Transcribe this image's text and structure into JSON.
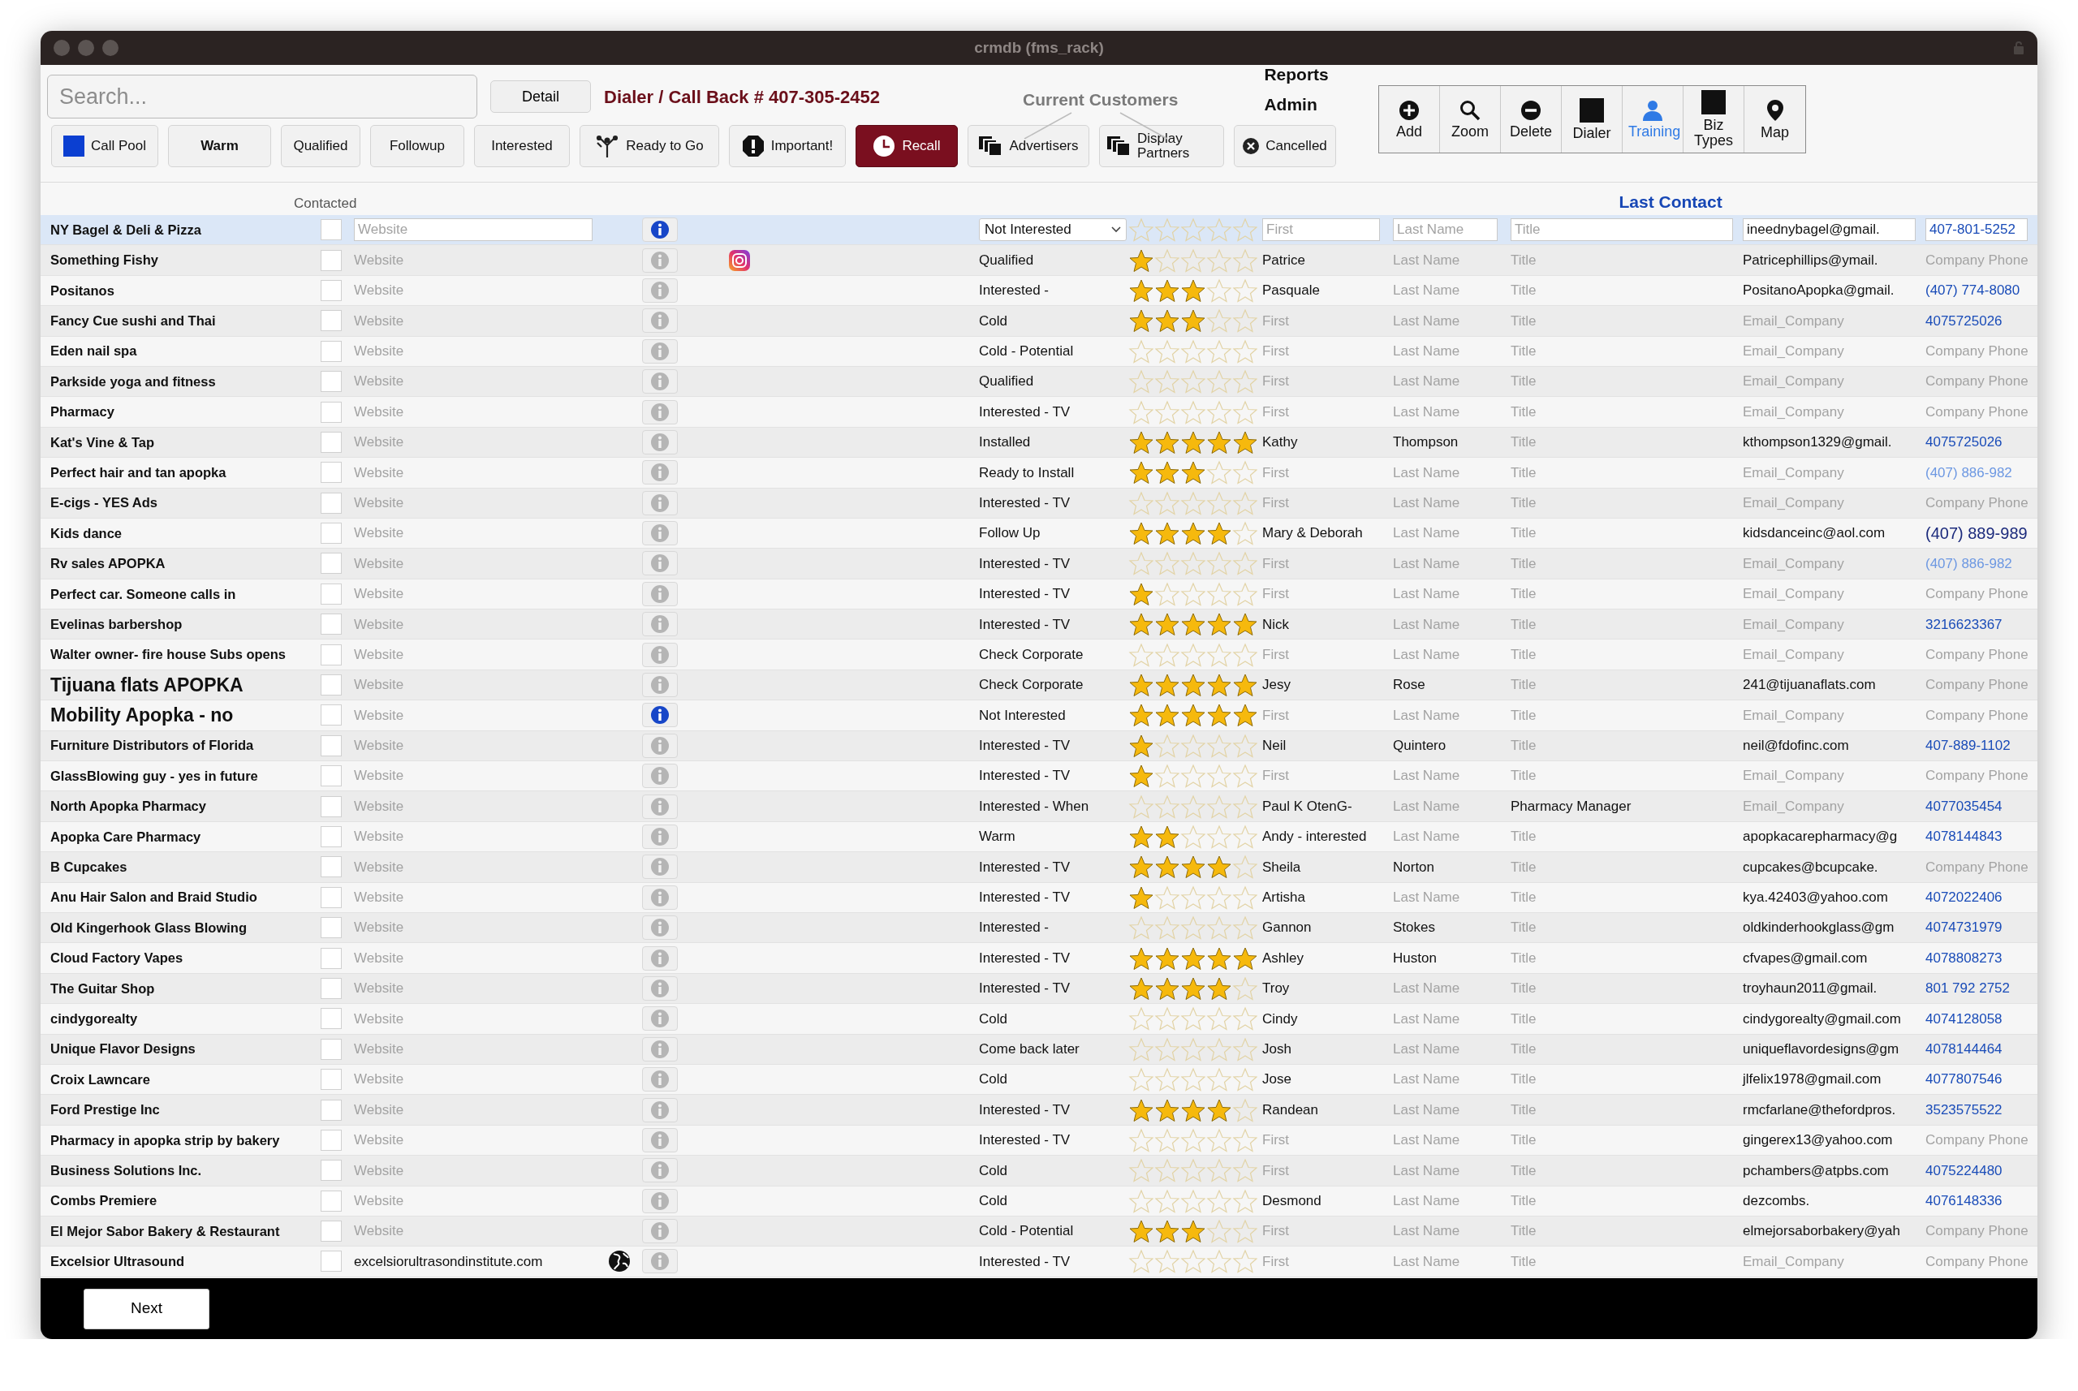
{
  "window": {
    "title": "crmdb (fms_rack)"
  },
  "search": {
    "placeholder": "Search..."
  },
  "detail_button": "Detail",
  "dialer_title": "Dialer / Call Back # 407-305-2452",
  "current_customers": "Current Customers",
  "menu_links": [
    "Reports",
    "Admin"
  ],
  "filters": [
    {
      "label": "Call Pool",
      "bold": false,
      "selected": false
    },
    {
      "label": "Warm",
      "bold": true,
      "selected": false
    },
    {
      "label": "Qualified",
      "bold": false,
      "selected": false
    },
    {
      "label": "Followup",
      "bold": false,
      "selected": false
    },
    {
      "label": "Interested",
      "bold": false,
      "selected": false
    },
    {
      "label": "Ready to Go",
      "bold": false,
      "selected": false
    },
    {
      "label": "Important!",
      "bold": false,
      "selected": false
    },
    {
      "label": "Recall",
      "bold": false,
      "selected": true
    },
    {
      "label": "Advertisers",
      "bold": false,
      "selected": false
    },
    {
      "label": "Display Partners",
      "bold": false,
      "selected": false
    },
    {
      "label": "Cancelled",
      "bold": false,
      "selected": false
    }
  ],
  "tools": [
    {
      "label": "Add",
      "selected": false
    },
    {
      "label": "Zoom",
      "selected": false
    },
    {
      "label": "Delete",
      "selected": false
    },
    {
      "label": "Dialer",
      "selected": false
    },
    {
      "label": "Training",
      "selected": true
    },
    {
      "label": "Biz Types",
      "selected": false
    },
    {
      "label": "Map",
      "selected": false
    }
  ],
  "column_headers": {
    "contacted": "Contacted",
    "last_contact": "Last Contact"
  },
  "rows": [
    {
      "name": "NY Bagel & Deli & Pizza",
      "large_name": false,
      "selected": true,
      "contacted": false,
      "website": {
        "placeholder": "Website"
      },
      "social": false,
      "has_info": true,
      "status": "Not Interested",
      "stars": 0,
      "first": {
        "placeholder": "First"
      },
      "last": {
        "placeholder": "Last Name"
      },
      "title": {
        "placeholder": "Title"
      },
      "email": "ineednybagel@gmail.",
      "phone": {
        "value": "407-801-5252",
        "kind": "link"
      }
    },
    {
      "name": "Something Fishy",
      "large_name": false,
      "selected": false,
      "contacted": false,
      "website": {
        "placeholder": "Website"
      },
      "social": true,
      "has_info": false,
      "status": "Qualified",
      "stars": 1,
      "first": "Patrice",
      "last": {
        "placeholder": "Last Name"
      },
      "title": {
        "placeholder": "Title"
      },
      "email": "Patricephillips@ymail.",
      "phone": {
        "placeholder": "Company Phone"
      }
    },
    {
      "name": "Positanos",
      "large_name": false,
      "selected": false,
      "contacted": false,
      "website": {
        "placeholder": "Website"
      },
      "social": false,
      "has_info": false,
      "status": "Interested -",
      "stars": 3,
      "first": "Pasquale",
      "last": {
        "placeholder": "Last Name"
      },
      "title": {
        "placeholder": "Title"
      },
      "email": "PositanoApopka@gmail.",
      "phone": {
        "value": "(407) 774-8080",
        "kind": "link"
      }
    },
    {
      "name": "Fancy Cue sushi and Thai",
      "large_name": false,
      "selected": false,
      "contacted": false,
      "website": {
        "placeholder": "Website"
      },
      "social": false,
      "has_info": false,
      "status": "Cold",
      "stars": 3,
      "first": {
        "placeholder": "First"
      },
      "last": {
        "placeholder": "Last Name"
      },
      "title": {
        "placeholder": "Title"
      },
      "email": {
        "placeholder": "Email_Company"
      },
      "phone": {
        "value": "4075725026",
        "kind": "link"
      }
    },
    {
      "name": "Eden nail spa",
      "large_name": false,
      "selected": false,
      "contacted": false,
      "website": {
        "placeholder": "Website"
      },
      "social": false,
      "has_info": false,
      "status": "Cold - Potential",
      "stars": 0,
      "first": {
        "placeholder": "First"
      },
      "last": {
        "placeholder": "Last Name"
      },
      "title": {
        "placeholder": "Title"
      },
      "email": {
        "placeholder": "Email_Company"
      },
      "phone": {
        "placeholder": "Company Phone"
      }
    },
    {
      "name": "Parkside yoga and fitness",
      "large_name": false,
      "selected": false,
      "contacted": false,
      "website": {
        "placeholder": "Website"
      },
      "social": false,
      "has_info": false,
      "status": "Qualified",
      "stars": 0,
      "first": {
        "placeholder": "First"
      },
      "last": {
        "placeholder": "Last Name"
      },
      "title": {
        "placeholder": "Title"
      },
      "email": {
        "placeholder": "Email_Company"
      },
      "phone": {
        "placeholder": "Company Phone"
      }
    },
    {
      "name": "Pharmacy",
      "large_name": false,
      "selected": false,
      "contacted": false,
      "website": {
        "placeholder": "Website"
      },
      "social": false,
      "has_info": false,
      "status": "Interested - TV",
      "stars": 0,
      "first": {
        "placeholder": "First"
      },
      "last": {
        "placeholder": "Last Name"
      },
      "title": {
        "placeholder": "Title"
      },
      "email": {
        "placeholder": "Email_Company"
      },
      "phone": {
        "placeholder": "Company Phone"
      }
    },
    {
      "name": "Kat's Vine & Tap",
      "large_name": false,
      "selected": false,
      "contacted": false,
      "website": {
        "placeholder": "Website"
      },
      "social": false,
      "has_info": false,
      "status": "Installed",
      "stars": 5,
      "first": "Kathy",
      "last": "Thompson",
      "title": {
        "placeholder": "Title"
      },
      "email": "kthompson1329@gmail.",
      "phone": {
        "value": "4075725026",
        "kind": "link"
      }
    },
    {
      "name": "Perfect hair and tan apopka",
      "large_name": false,
      "selected": false,
      "contacted": false,
      "website": {
        "placeholder": "Website"
      },
      "social": false,
      "has_info": false,
      "status": "Ready to Install",
      "stars": 3,
      "first": {
        "placeholder": "First"
      },
      "last": {
        "placeholder": "Last Name"
      },
      "title": {
        "placeholder": "Title"
      },
      "email": {
        "placeholder": "Email_Company"
      },
      "phone": {
        "value": "(407) 886-982",
        "kind": "faded"
      }
    },
    {
      "name": "E-cigs - YES Ads",
      "large_name": false,
      "selected": false,
      "contacted": false,
      "website": {
        "placeholder": "Website"
      },
      "social": false,
      "has_info": false,
      "status": "Interested - TV",
      "stars": 0,
      "first": {
        "placeholder": "First"
      },
      "last": {
        "placeholder": "Last Name"
      },
      "title": {
        "placeholder": "Title"
      },
      "email": {
        "placeholder": "Email_Company"
      },
      "phone": {
        "placeholder": "Company Phone"
      }
    },
    {
      "name": "Kids dance",
      "large_name": false,
      "selected": false,
      "contacted": false,
      "website": {
        "placeholder": "Website"
      },
      "social": false,
      "has_info": false,
      "status": "Follow Up",
      "stars": 4,
      "first": "Mary & Deborah",
      "last": {
        "placeholder": "Last Name"
      },
      "title": {
        "placeholder": "Title"
      },
      "email": "kidsdanceinc@aol.com",
      "phone": {
        "value": "(407) 889-989",
        "kind": "large"
      }
    },
    {
      "name": "Rv sales APOPKA",
      "large_name": false,
      "selected": false,
      "contacted": false,
      "website": {
        "placeholder": "Website"
      },
      "social": false,
      "has_info": false,
      "status": "Interested - TV",
      "stars": 0,
      "first": {
        "placeholder": "First"
      },
      "last": {
        "placeholder": "Last Name"
      },
      "title": {
        "placeholder": "Title"
      },
      "email": {
        "placeholder": "Email_Company"
      },
      "phone": {
        "value": "(407) 886-982",
        "kind": "faded"
      }
    },
    {
      "name": "Perfect car. Someone calls in",
      "large_name": false,
      "selected": false,
      "contacted": false,
      "website": {
        "placeholder": "Website"
      },
      "social": false,
      "has_info": false,
      "status": "Interested - TV",
      "stars": 1,
      "first": {
        "placeholder": "First"
      },
      "last": {
        "placeholder": "Last Name"
      },
      "title": {
        "placeholder": "Title"
      },
      "email": {
        "placeholder": "Email_Company"
      },
      "phone": {
        "placeholder": "Company Phone"
      }
    },
    {
      "name": "Evelinas barbershop",
      "large_name": false,
      "selected": false,
      "contacted": false,
      "website": {
        "placeholder": "Website"
      },
      "social": false,
      "has_info": false,
      "status": "Interested - TV",
      "stars": 5,
      "first": "Nick",
      "last": {
        "placeholder": "Last Name"
      },
      "title": {
        "placeholder": "Title"
      },
      "email": {
        "placeholder": "Email_Company"
      },
      "phone": {
        "value": "3216623367",
        "kind": "link"
      }
    },
    {
      "name": "Walter owner- fire house Subs opens",
      "large_name": false,
      "selected": false,
      "contacted": false,
      "website": {
        "placeholder": "Website"
      },
      "social": false,
      "has_info": false,
      "status": "Check Corporate",
      "stars": 0,
      "first": {
        "placeholder": "First"
      },
      "last": {
        "placeholder": "Last Name"
      },
      "title": {
        "placeholder": "Title"
      },
      "email": {
        "placeholder": "Email_Company"
      },
      "phone": {
        "placeholder": "Company Phone"
      }
    },
    {
      "name": "Tijuana flats APOPKA",
      "large_name": true,
      "selected": false,
      "contacted": false,
      "website": {
        "placeholder": "Website"
      },
      "social": false,
      "has_info": false,
      "status": "Check Corporate",
      "stars": 5,
      "first": "Jesy",
      "last": "Rose",
      "title": {
        "placeholder": "Title"
      },
      "email": "241@tijuanaflats.com",
      "phone": {
        "placeholder": "Company Phone"
      }
    },
    {
      "name": "Mobility Apopka - no",
      "large_name": true,
      "selected": false,
      "contacted": false,
      "website": {
        "placeholder": "Website"
      },
      "social": false,
      "has_info": true,
      "status": "Not Interested",
      "stars": 5,
      "first": {
        "placeholder": "First"
      },
      "last": {
        "placeholder": "Last Name"
      },
      "title": {
        "placeholder": "Title"
      },
      "email": {
        "placeholder": "Email_Company"
      },
      "phone": {
        "placeholder": "Company Phone"
      }
    },
    {
      "name": "Furniture Distributors of Florida",
      "large_name": false,
      "selected": false,
      "contacted": false,
      "website": {
        "placeholder": "Website"
      },
      "social": false,
      "has_info": false,
      "status": "Interested - TV",
      "stars": 1,
      "first": "Neil",
      "last": "Quintero",
      "title": {
        "placeholder": "Title"
      },
      "email": "neil@fdofinc.com",
      "phone": {
        "value": "407-889-1102",
        "kind": "link"
      }
    },
    {
      "name": "GlassBlowing guy - yes in future",
      "large_name": false,
      "selected": false,
      "contacted": false,
      "website": {
        "placeholder": "Website"
      },
      "social": false,
      "has_info": false,
      "status": "Interested - TV",
      "stars": 1,
      "first": {
        "placeholder": "First"
      },
      "last": {
        "placeholder": "Last Name"
      },
      "title": {
        "placeholder": "Title"
      },
      "email": {
        "placeholder": "Email_Company"
      },
      "phone": {
        "placeholder": "Company Phone"
      }
    },
    {
      "name": "North Apopka Pharmacy",
      "large_name": false,
      "selected": false,
      "contacted": false,
      "website": {
        "placeholder": "Website"
      },
      "social": false,
      "has_info": false,
      "status": "Interested - When",
      "stars": 0,
      "first": "Paul K OtenG-",
      "last": {
        "placeholder": "Last Name"
      },
      "title": "Pharmacy Manager",
      "email": {
        "placeholder": "Email_Company"
      },
      "phone": {
        "value": "4077035454",
        "kind": "link"
      }
    },
    {
      "name": "Apopka Care Pharmacy",
      "large_name": false,
      "selected": false,
      "contacted": false,
      "website": {
        "placeholder": "Website"
      },
      "social": false,
      "has_info": false,
      "status": "Warm",
      "stars": 2,
      "first": "Andy - interested",
      "last": {
        "placeholder": "Last Name"
      },
      "title": {
        "placeholder": "Title"
      },
      "email": "apopkacarepharmacy@g",
      "phone": {
        "value": "4078144843",
        "kind": "link"
      }
    },
    {
      "name": "B Cupcakes",
      "large_name": false,
      "selected": false,
      "contacted": false,
      "website": {
        "placeholder": "Website"
      },
      "social": false,
      "has_info": false,
      "status": "Interested - TV",
      "stars": 4,
      "first": "Sheila",
      "last": "Norton",
      "title": {
        "placeholder": "Title"
      },
      "email": "cupcakes@bcupcake.",
      "phone": {
        "placeholder": "Company Phone"
      }
    },
    {
      "name": "Anu Hair Salon and Braid Studio",
      "large_name": false,
      "selected": false,
      "contacted": false,
      "website": {
        "placeholder": "Website"
      },
      "social": false,
      "has_info": false,
      "status": "Interested - TV",
      "stars": 1,
      "first": "Artisha",
      "last": {
        "placeholder": "Last Name"
      },
      "title": {
        "placeholder": "Title"
      },
      "email": "kya.42403@yahoo.com",
      "phone": {
        "value": "4072022406",
        "kind": "link"
      }
    },
    {
      "name": "Old Kingerhook Glass Blowing",
      "large_name": false,
      "selected": false,
      "contacted": false,
      "website": {
        "placeholder": "Website"
      },
      "social": false,
      "has_info": false,
      "status": "Interested -",
      "stars": 0,
      "first": "Gannon",
      "last": "Stokes",
      "title": {
        "placeholder": "Title"
      },
      "email": "oldkinderhookglass@gm",
      "phone": {
        "value": "4074731979",
        "kind": "link"
      }
    },
    {
      "name": "Cloud Factory Vapes",
      "large_name": false,
      "selected": false,
      "contacted": false,
      "website": {
        "placeholder": "Website"
      },
      "social": false,
      "has_info": false,
      "status": "Interested - TV",
      "stars": 5,
      "first": "Ashley",
      "last": "Huston",
      "title": {
        "placeholder": "Title"
      },
      "email": "cfvapes@gmail.com",
      "phone": {
        "value": "4078808273",
        "kind": "link"
      }
    },
    {
      "name": "The Guitar Shop",
      "large_name": false,
      "selected": false,
      "contacted": false,
      "website": {
        "placeholder": "Website"
      },
      "social": false,
      "has_info": false,
      "status": "Interested - TV",
      "stars": 4,
      "first": "Troy",
      "last": {
        "placeholder": "Last Name"
      },
      "title": {
        "placeholder": "Title"
      },
      "email": "troyhaun2011@gmail.",
      "phone": {
        "value": "801 792 2752",
        "kind": "link"
      }
    },
    {
      "name": "cindygorealty",
      "large_name": false,
      "selected": false,
      "contacted": false,
      "website": {
        "placeholder": "Website"
      },
      "social": false,
      "has_info": false,
      "status": "Cold",
      "stars": 0,
      "first": "Cindy",
      "last": {
        "placeholder": "Last Name"
      },
      "title": {
        "placeholder": "Title"
      },
      "email": "cindygorealty@gmail.com",
      "phone": {
        "value": "4074128058",
        "kind": "link"
      }
    },
    {
      "name": "Unique Flavor Designs",
      "large_name": false,
      "selected": false,
      "contacted": false,
      "website": {
        "placeholder": "Website"
      },
      "social": false,
      "has_info": false,
      "status": "Come back later",
      "stars": 0,
      "first": "Josh",
      "last": {
        "placeholder": "Last Name"
      },
      "title": {
        "placeholder": "Title"
      },
      "email": "uniqueflavordesigns@gm",
      "phone": {
        "value": "4078144464",
        "kind": "link"
      }
    },
    {
      "name": "Croix Lawncare",
      "large_name": false,
      "selected": false,
      "contacted": false,
      "website": {
        "placeholder": "Website"
      },
      "social": false,
      "has_info": false,
      "status": "Cold",
      "stars": 0,
      "first": "Jose",
      "last": {
        "placeholder": "Last Name"
      },
      "title": {
        "placeholder": "Title"
      },
      "email": "jlfelix1978@gmail.com",
      "phone": {
        "value": "4077807546",
        "kind": "link"
      }
    },
    {
      "name": "Ford Prestige Inc",
      "large_name": false,
      "selected": false,
      "contacted": false,
      "website": {
        "placeholder": "Website"
      },
      "social": false,
      "has_info": false,
      "status": "Interested - TV",
      "stars": 4,
      "first": "Randean",
      "last": {
        "placeholder": "Last Name"
      },
      "title": {
        "placeholder": "Title"
      },
      "email": "rmcfarlane@thefordpros.",
      "phone": {
        "value": "3523575522",
        "kind": "link"
      }
    },
    {
      "name": "Pharmacy in apopka strip by bakery",
      "large_name": false,
      "selected": false,
      "contacted": false,
      "website": {
        "placeholder": "Website"
      },
      "social": false,
      "has_info": false,
      "status": "Interested - TV",
      "stars": 0,
      "first": {
        "placeholder": "First"
      },
      "last": {
        "placeholder": "Last Name"
      },
      "title": {
        "placeholder": "Title"
      },
      "email": "gingerex13@yahoo.com",
      "phone": {
        "placeholder": "Company Phone"
      }
    },
    {
      "name": "Business Solutions Inc.",
      "large_name": false,
      "selected": false,
      "contacted": false,
      "website": {
        "placeholder": "Website"
      },
      "social": false,
      "has_info": false,
      "status": "Cold",
      "stars": 0,
      "first": {
        "placeholder": "First"
      },
      "last": {
        "placeholder": "Last Name"
      },
      "title": {
        "placeholder": "Title"
      },
      "email": "pchambers@atpbs.com",
      "phone": {
        "value": "4075224480",
        "kind": "link"
      }
    },
    {
      "name": "Combs Premiere",
      "large_name": false,
      "selected": false,
      "contacted": false,
      "website": {
        "placeholder": "Website"
      },
      "social": false,
      "has_info": false,
      "status": "Cold",
      "stars": 0,
      "first": "Desmond",
      "last": {
        "placeholder": "Last Name"
      },
      "title": {
        "placeholder": "Title"
      },
      "email": "dezcombs.",
      "phone": {
        "value": "4076148336",
        "kind": "link"
      }
    },
    {
      "name": "El Mejor Sabor Bakery & Restaurant",
      "large_name": false,
      "selected": false,
      "contacted": false,
      "website": {
        "placeholder": "Website"
      },
      "social": false,
      "has_info": false,
      "status": "Cold - Potential",
      "stars": 3,
      "first": {
        "placeholder": "First"
      },
      "last": {
        "placeholder": "Last Name"
      },
      "title": {
        "placeholder": "Title"
      },
      "email": "elmejorsaborbakery@yah",
      "phone": {
        "placeholder": "Company Phone"
      }
    },
    {
      "name": "Excelsior Ultrasound",
      "large_name": false,
      "selected": false,
      "contacted": false,
      "website": "excelsiorultrasondinstitute.com",
      "social": false,
      "has_info": false,
      "status": "Interested - TV",
      "stars": 0,
      "first": {
        "placeholder": "First"
      },
      "last": {
        "placeholder": "Last Name"
      },
      "title": {
        "placeholder": "Title"
      },
      "email": {
        "placeholder": "Email_Company"
      },
      "phone": {
        "placeholder": "Company Phone"
      }
    }
  ],
  "next_button": "Next"
}
